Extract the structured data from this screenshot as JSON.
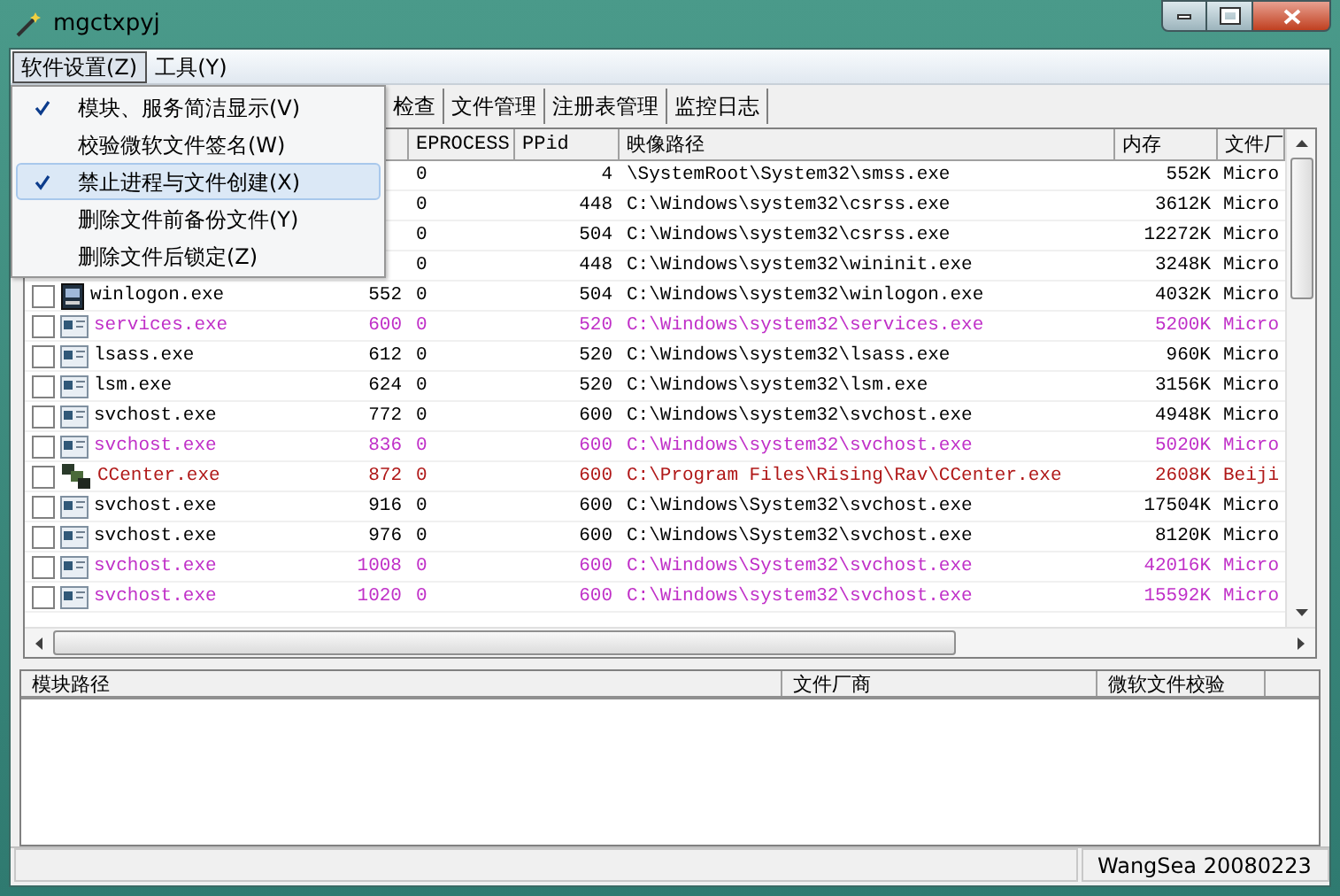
{
  "window": {
    "title": "mgctxpyj"
  },
  "menu_bar": [
    {
      "label": "软件设置(Z)",
      "selected": true
    },
    {
      "label": "工具(Y)",
      "selected": false
    }
  ],
  "menu": [
    {
      "label": "模块、服务简洁显示(V)",
      "checked": true,
      "selected": false
    },
    {
      "label": "校验微软文件签名(W)",
      "checked": false,
      "selected": false
    },
    {
      "label": "禁止进程与文件创建(X)",
      "checked": true,
      "selected": true
    },
    {
      "label": "删除文件前备份文件(Y)",
      "checked": false,
      "selected": false
    },
    {
      "label": "删除文件后锁定(Z)",
      "checked": false,
      "selected": false
    }
  ],
  "tabs": [
    {
      "label": "检查",
      "selected": false
    },
    {
      "label": "文件管理",
      "selected": false
    },
    {
      "label": "注册表管理",
      "selected": false
    },
    {
      "label": "监控日志",
      "selected": false
    }
  ],
  "table": {
    "columns": [
      "EPROCESS",
      "PPid",
      "映像路径",
      "内存",
      "文件厂"
    ],
    "rows": [
      {
        "color": "#000000",
        "eprocess": "0",
        "ppid": "4",
        "path": "\\SystemRoot\\System32\\smss.exe",
        "memory": "552K",
        "vendor": "Micro"
      },
      {
        "color": "#000000",
        "eprocess": "0",
        "ppid": "448",
        "path": "C:\\Windows\\system32\\csrss.exe",
        "memory": "3612K",
        "vendor": "Micro"
      },
      {
        "color": "#000000",
        "eprocess": "0",
        "ppid": "504",
        "path": "C:\\Windows\\system32\\csrss.exe",
        "memory": "12272K",
        "vendor": "Micro"
      },
      {
        "color": "#000000",
        "eprocess": "0",
        "ppid": "448",
        "path": "C:\\Windows\\system32\\wininit.exe",
        "memory": "3248K",
        "vendor": "Micro"
      },
      {
        "checked": false,
        "color": "#000000",
        "kind": "logon",
        "name": "winlogon.exe",
        "pid": "552",
        "eprocess": "0",
        "ppid": "504",
        "path": "C:\\Windows\\system32\\winlogon.exe",
        "memory": "4032K",
        "vendor": "Micro"
      },
      {
        "checked": false,
        "color": "#c030c8",
        "kind": "window",
        "name": "services.exe",
        "pid": "600",
        "eprocess": "0",
        "ppid": "520",
        "path": "C:\\Windows\\system32\\services.exe",
        "memory": "5200K",
        "vendor": "Micro"
      },
      {
        "checked": false,
        "color": "#000000",
        "kind": "window",
        "name": "lsass.exe",
        "pid": "612",
        "eprocess": "0",
        "ppid": "520",
        "path": "C:\\Windows\\system32\\lsass.exe",
        "memory": "960K",
        "vendor": "Micro"
      },
      {
        "checked": false,
        "color": "#000000",
        "kind": "window",
        "name": "lsm.exe",
        "pid": "624",
        "eprocess": "0",
        "ppid": "520",
        "path": "C:\\Windows\\system32\\lsm.exe",
        "memory": "3156K",
        "vendor": "Micro"
      },
      {
        "checked": false,
        "color": "#000000",
        "kind": "window",
        "name": "svchost.exe",
        "pid": "772",
        "eprocess": "0",
        "ppid": "600",
        "path": "C:\\Windows\\system32\\svchost.exe",
        "memory": "4948K",
        "vendor": "Micro"
      },
      {
        "checked": false,
        "color": "#c030c8",
        "kind": "window",
        "name": "svchost.exe",
        "pid": "836",
        "eprocess": "0",
        "ppid": "600",
        "path": "C:\\Windows\\system32\\svchost.exe",
        "memory": "5020K",
        "vendor": "Micro"
      },
      {
        "checked": false,
        "color": "#b01818",
        "kind": "cubes",
        "name": "CCenter.exe",
        "pid": "872",
        "eprocess": "0",
        "ppid": "600",
        "path": "C:\\Program Files\\Rising\\Rav\\CCenter.exe",
        "memory": "2608K",
        "vendor": "Beiji"
      },
      {
        "checked": false,
        "color": "#000000",
        "kind": "window",
        "name": "svchost.exe",
        "pid": "916",
        "eprocess": "0",
        "ppid": "600",
        "path": "C:\\Windows\\System32\\svchost.exe",
        "memory": "17504K",
        "vendor": "Micro"
      },
      {
        "checked": false,
        "color": "#000000",
        "kind": "window",
        "name": "svchost.exe",
        "pid": "976",
        "eprocess": "0",
        "ppid": "600",
        "path": "C:\\Windows\\System32\\svchost.exe",
        "memory": "8120K",
        "vendor": "Micro"
      },
      {
        "checked": false,
        "color": "#c030c8",
        "kind": "window",
        "name": "svchost.exe",
        "pid": "1008",
        "eprocess": "0",
        "ppid": "600",
        "path": "C:\\Windows\\System32\\svchost.exe",
        "memory": "42016K",
        "vendor": "Micro"
      },
      {
        "checked": false,
        "color": "#c030c8",
        "kind": "window",
        "name": "svchost.exe",
        "pid": "1020",
        "eprocess": "0",
        "ppid": "600",
        "path": "C:\\Windows\\system32\\svchost.exe",
        "memory": "15592K",
        "vendor": "Micro"
      }
    ]
  },
  "module_table": {
    "columns": [
      "模块路径",
      "文件厂商",
      "微软文件校验"
    ]
  },
  "status_bar": {
    "text": "WangSea 20080223"
  }
}
